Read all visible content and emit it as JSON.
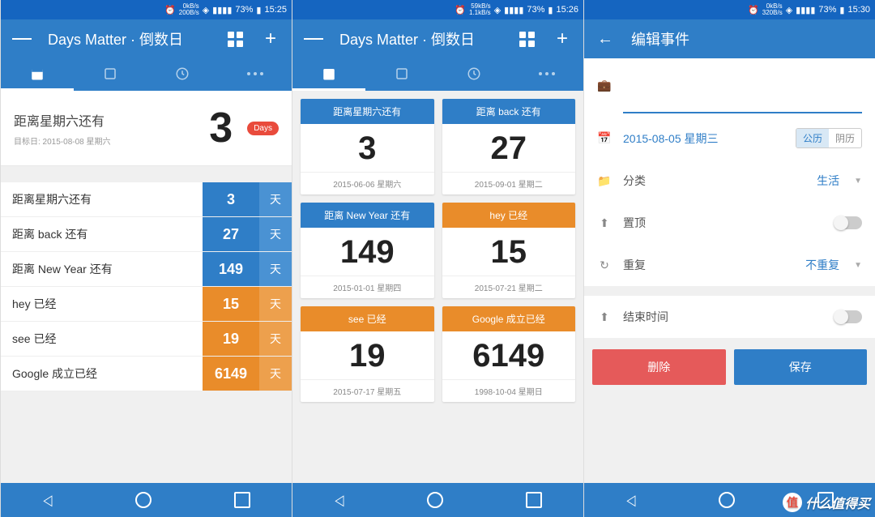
{
  "status": [
    {
      "speed1": "0kB/s",
      "speed2": "200B/s",
      "battery": "73%",
      "time": "15:25"
    },
    {
      "speed1": "59kB/s",
      "speed2": "1.1kB/s",
      "battery": "73%",
      "time": "15:26"
    },
    {
      "speed1": "0kB/s",
      "speed2": "320B/s",
      "battery": "73%",
      "time": "15:30"
    }
  ],
  "appbar": {
    "title": "Days Matter · 倒数日"
  },
  "edit": {
    "title": "编辑事件",
    "date": "2015-08-05 星期三",
    "cal_solar": "公历",
    "cal_lunar": "阴历",
    "category_label": "分类",
    "category_value": "生活",
    "pin_label": "置顶",
    "repeat_label": "重复",
    "repeat_value": "不重复",
    "end_label": "结束时间",
    "delete": "删除",
    "save": "保存"
  },
  "featured": {
    "title": "距离星期六还有",
    "sub": "目标日: 2015-08-08 星期六",
    "num": "3",
    "badge": "Days"
  },
  "list": [
    {
      "label": "距离星期六还有",
      "count": "3",
      "unit": "天",
      "future": true
    },
    {
      "label": "距离 back 还有",
      "count": "27",
      "unit": "天",
      "future": true
    },
    {
      "label": "距离 New Year 还有",
      "count": "149",
      "unit": "天",
      "future": true
    },
    {
      "label": "hey 已经",
      "count": "15",
      "unit": "天",
      "future": false
    },
    {
      "label": "see 已经",
      "count": "19",
      "unit": "天",
      "future": false
    },
    {
      "label": "Google 成立已经",
      "count": "6149",
      "unit": "天",
      "future": false
    }
  ],
  "cards": [
    {
      "head": "距离星期六还有",
      "num": "3",
      "date": "2015-06-06 星期六",
      "future": true
    },
    {
      "head": "距离 back 还有",
      "num": "27",
      "date": "2015-09-01 星期二",
      "future": true
    },
    {
      "head": "距离 New Year 还有",
      "num": "149",
      "date": "2015-01-01 星期四",
      "future": true
    },
    {
      "head": "hey 已经",
      "num": "15",
      "date": "2015-07-21 星期二",
      "future": false
    },
    {
      "head": "see 已经",
      "num": "19",
      "date": "2015-07-17 星期五",
      "future": false
    },
    {
      "head": "Google 成立已经",
      "num": "6149",
      "date": "1998-10-04 星期日",
      "future": false
    }
  ],
  "watermark": "什么值得买"
}
